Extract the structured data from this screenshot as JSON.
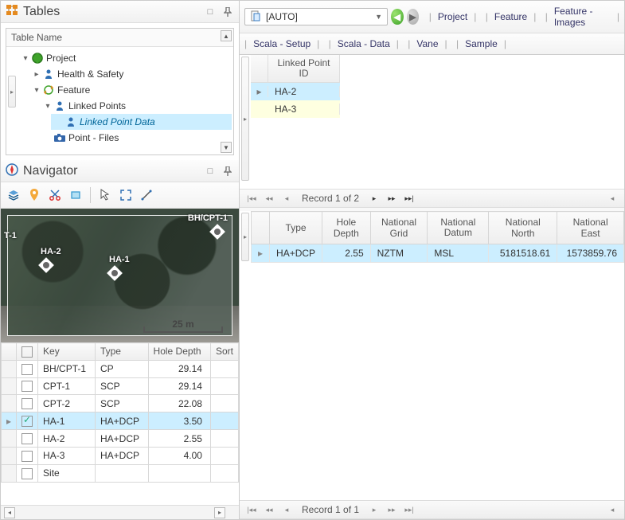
{
  "tables_panel": {
    "title": "Tables",
    "tree_header": "Table Name",
    "nodes": {
      "project": "Project",
      "health_safety": "Health & Safety",
      "feature": "Feature",
      "linked_points": "Linked Points",
      "linked_point_data": "Linked Point Data",
      "point_files": "Point - Files"
    }
  },
  "navigator_panel": {
    "title": "Navigator",
    "map": {
      "scale_label": "25 m",
      "markers": {
        "t1": "T-1",
        "ha2": "HA-2",
        "ha1": "HA-1",
        "bhcpt1": "BH/CPT-1"
      }
    },
    "columns": {
      "key": "Key",
      "type": "Type",
      "hole_depth": "Hole Depth",
      "sort": "Sort"
    },
    "rows": [
      {
        "key": "BH/CPT-1",
        "type": "CP",
        "hole_depth": "29.14",
        "checked": false,
        "selected": false
      },
      {
        "key": "CPT-1",
        "type": "SCP",
        "hole_depth": "29.14",
        "checked": false,
        "selected": false
      },
      {
        "key": "CPT-2",
        "type": "SCP",
        "hole_depth": "22.08",
        "checked": false,
        "selected": false
      },
      {
        "key": "HA-1",
        "type": "HA+DCP",
        "hole_depth": "3.50",
        "checked": true,
        "selected": true
      },
      {
        "key": "HA-2",
        "type": "HA+DCP",
        "hole_depth": "2.55",
        "checked": false,
        "selected": false
      },
      {
        "key": "HA-3",
        "type": "HA+DCP",
        "hole_depth": "4.00",
        "checked": false,
        "selected": false
      },
      {
        "key": "Site",
        "type": "",
        "hole_depth": "",
        "checked": false,
        "selected": false
      }
    ]
  },
  "right_pane": {
    "dropdown_label": "[AUTO]",
    "tabs1": [
      "Project",
      "Feature",
      "Feature - Images"
    ],
    "tabs2": [
      "Scala - Setup",
      "Scala - Data",
      "Vane",
      "Sample"
    ],
    "linked_grid": {
      "header": "Linked Point ID",
      "rows": [
        {
          "id": "HA-2",
          "selected": true
        },
        {
          "id": "HA-3",
          "selected": false
        }
      ]
    },
    "recnav_top": "Record 1 of 2",
    "recnav_bottom": "Record 1 of 1",
    "detail": {
      "columns": {
        "type": "Type",
        "hole_depth": "Hole Depth",
        "national_grid": "National Grid",
        "national_datum": "National Datum",
        "national_north": "National North",
        "national_east": "National East"
      },
      "row": {
        "type": "HA+DCP",
        "hole_depth": "2.55",
        "national_grid": "NZTM",
        "national_datum": "MSL",
        "national_north": "5181518.61",
        "national_east": "1573859.76"
      }
    }
  }
}
